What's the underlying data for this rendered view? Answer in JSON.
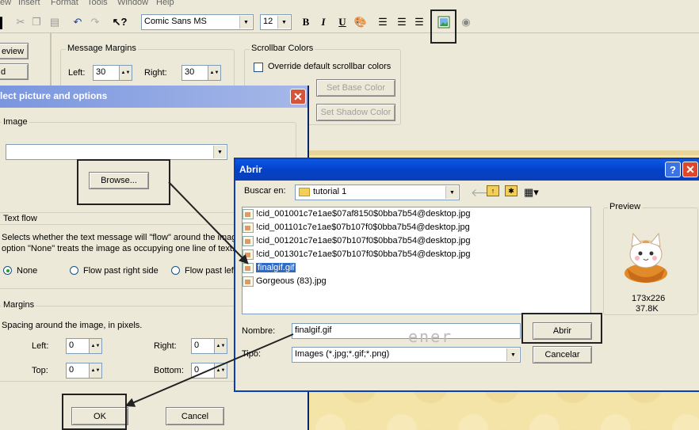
{
  "menu": [
    "ew",
    "Insert",
    "Format",
    "Tools",
    "Window",
    "Help"
  ],
  "toolbar": {
    "font": "Comic Sans MS",
    "size": "12",
    "bold": "B",
    "italic": "I",
    "underline": "U"
  },
  "bg_panel": {
    "preview_btn": "eview",
    "d_btn": "d",
    "margins_title": "Message Margins",
    "left_label": "Left:",
    "left_value": "30",
    "right_label": "Right:",
    "right_value": "30",
    "scroll_title": "Scrollbar Colors",
    "override_label": "Override default scrollbar colors",
    "base_btn": "Set Base Color",
    "shadow_btn": "Set Shadow Color"
  },
  "select_dialog": {
    "title": "lect picture and options",
    "image_group": "Image",
    "browse_btn": "Browse...",
    "textflow_group": "Text flow",
    "textflow_desc1": "Selects whether the text message will \"flow\" around the image",
    "textflow_desc2": "option \"None\" treats the image as occupying one line of text.",
    "opt_none": "None",
    "opt_right": "Flow past right side",
    "opt_left": "Flow past left",
    "margins_group": "Margins",
    "margins_desc": "Spacing around the image, in pixels.",
    "left_label": "Left:",
    "left_value": "0",
    "right_label": "Right:",
    "right_value": "0",
    "top_label": "Top:",
    "top_value": "0",
    "bottom_label": "Bottom:",
    "bottom_value": "0",
    "ok_btn": "OK",
    "cancel_btn": "Cancel"
  },
  "open_dialog": {
    "title": "Abrir",
    "lookin_label": "Buscar en:",
    "lookin_value": "tutorial 1",
    "files": [
      "!cid_001001c7e1ae$07af8150$0bba7b54@desktop.jpg",
      "!cid_001101c7e1ae$07b107f0$0bba7b54@desktop.jpg",
      "!cid_001201c7e1ae$07b107f0$0bba7b54@desktop.jpg",
      "!cid_001301c7e1ae$07b107f0$0bba7b54@desktop.jpg",
      "finalgif.gif",
      "Gorgeous (83).jpg"
    ],
    "selected_index": 4,
    "preview_title": "Preview",
    "preview_dims": "173x226",
    "preview_size": "37.8K",
    "name_label": "Nombre:",
    "name_value": "finalgif.gif",
    "type_label": "Tipo:",
    "type_value": "Images (*.jpg;*.gif;*.png)",
    "open_btn": "Abrir",
    "cancel_btn": "Cancelar",
    "watermark": "ener"
  },
  "colors": {
    "xp_blue": "#0a246a",
    "title_grad_start": "#0054e3",
    "close_red": "#e0472a",
    "bg_face": "#ece9d8"
  }
}
